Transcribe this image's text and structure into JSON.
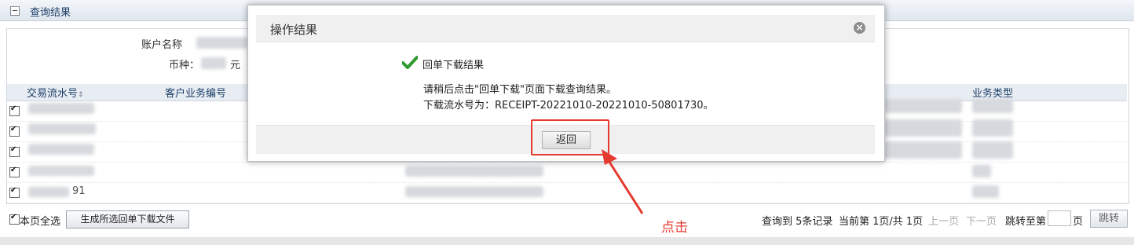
{
  "panel": {
    "title": "查询结果"
  },
  "info": {
    "account_name_label": "账户名称",
    "currency_label": "币种：",
    "currency_unit": "元"
  },
  "table": {
    "headers": [
      "交易流水号",
      "客户业务编号",
      "业务类型"
    ],
    "row5_serial_tail": "91",
    "row_count": 5
  },
  "footer": {
    "select_all_label": "本页全选",
    "generate_button": "生成所选回单下载文件",
    "record_count": "查询到 5条记录",
    "page_info": "当前第 1页/共 1页",
    "prev_page": "上一页",
    "next_page": "下一页",
    "jump_to": "跳转至第",
    "page_suffix": "页",
    "jump_button": "跳转"
  },
  "modal": {
    "title": "操作结果",
    "status": "回单下载结果",
    "line1": "请稍后点击\"回单下载\"页面下载查询结果。",
    "line2": "下载流水号为：RECEIPT-20221010-20221010-50801730。",
    "back_button": "返回"
  },
  "annotation": {
    "note": "点击"
  },
  "colors": {
    "accent_red": "#e53a2f",
    "check_green": "#2e9b2e",
    "header_blue": "#1d3f6a"
  },
  "icons": [
    "collapse-icon",
    "close-icon",
    "check-icon",
    "arrow-icon",
    "checkbox-icon"
  ]
}
